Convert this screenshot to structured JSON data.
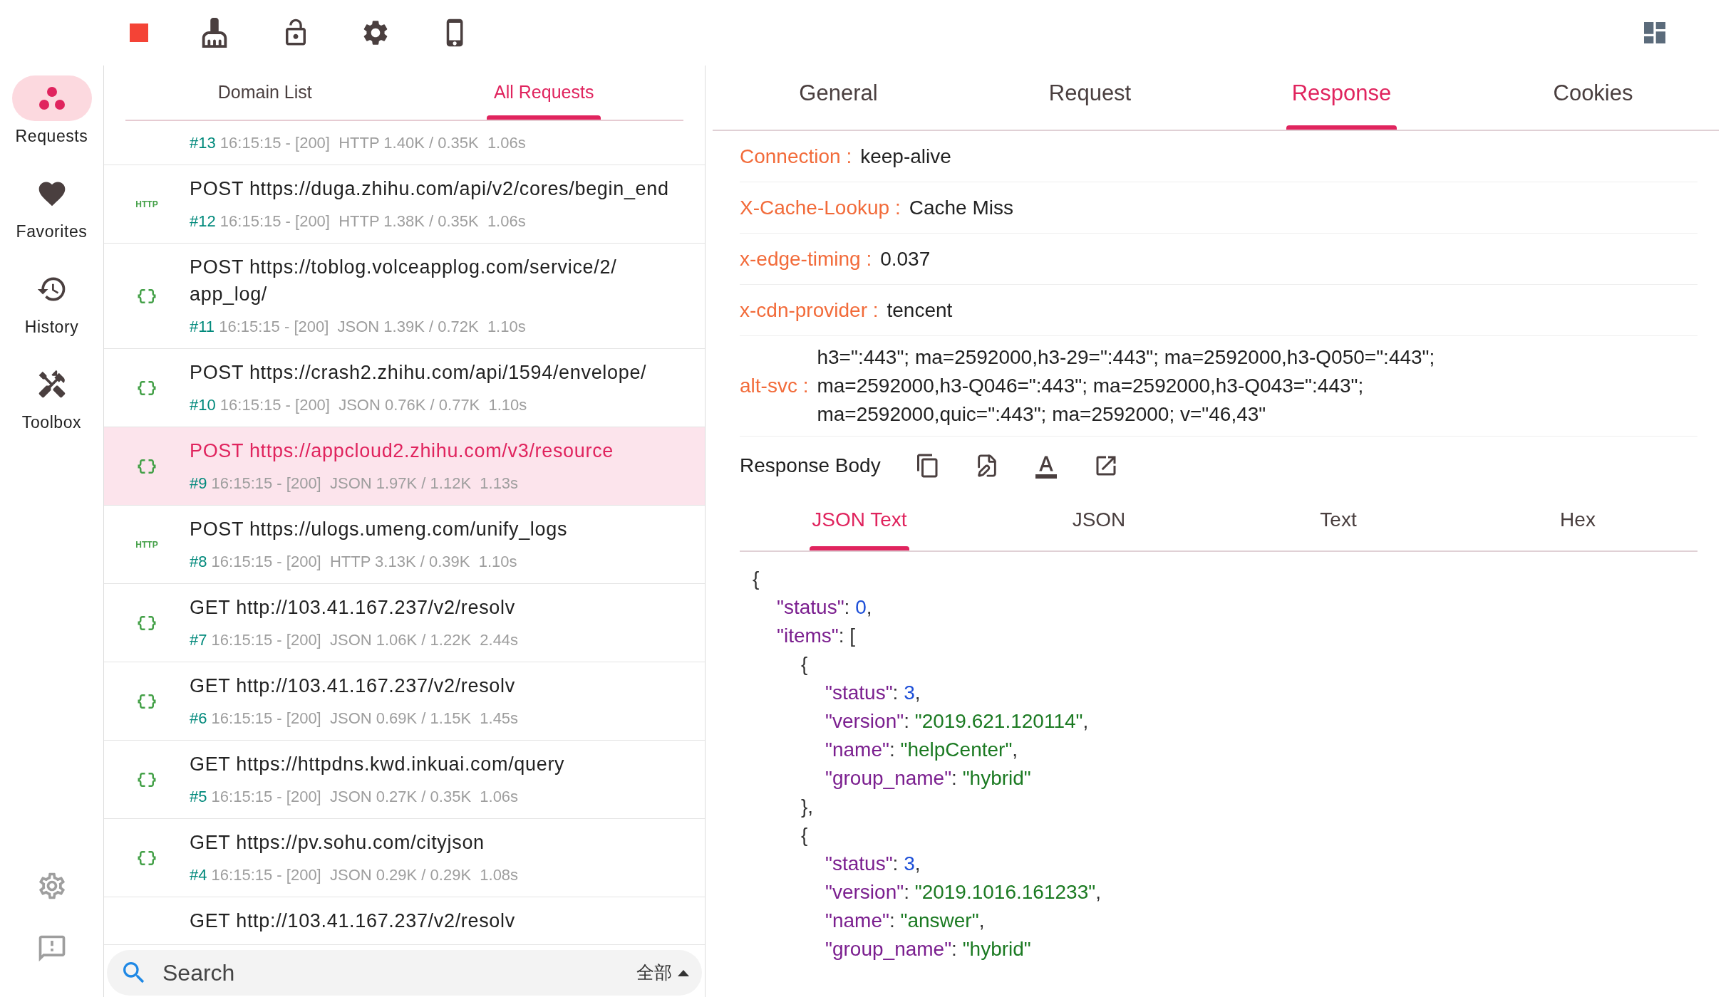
{
  "toolbar": {
    "recording": true
  },
  "sidebar": {
    "items": [
      {
        "label": "Requests",
        "kind": "requests",
        "selected": true
      },
      {
        "label": "Favorites",
        "kind": "favorites",
        "selected": false
      },
      {
        "label": "History",
        "kind": "history",
        "selected": false
      },
      {
        "label": "Toolbox",
        "kind": "toolbox",
        "selected": false
      }
    ]
  },
  "list_tabs": [
    {
      "label": "Domain List",
      "selected": false
    },
    {
      "label": "All Requests",
      "selected": true
    }
  ],
  "requests": [
    {
      "kind": "http",
      "number": "#13",
      "meta": "16:15:15 - [200]  HTTP 1.40K / 0.35K  1.06s",
      "selected": false
    },
    {
      "kind": "http",
      "badge": "HTTP",
      "title": "POST https://duga.zhihu.com/api/v2/cores/begin_end",
      "number": "#12",
      "meta": "16:15:15 - [200]  HTTP 1.38K / 0.35K  1.06s",
      "selected": false
    },
    {
      "kind": "json",
      "title": "POST https://toblog.volceapplog.com/service/2/ app_log/",
      "number": "#11",
      "meta": "16:15:15 - [200]  JSON 1.39K / 0.72K  1.10s",
      "selected": false
    },
    {
      "kind": "json",
      "title": "POST https://crash2.zhihu.com/api/1594/envelope/",
      "number": "#10",
      "meta": "16:15:15 - [200]  JSON 0.76K / 0.77K  1.10s",
      "selected": false
    },
    {
      "kind": "json",
      "title": "POST https://appcloud2.zhihu.com/v3/resource",
      "number": "#9",
      "meta": "16:15:15 - [200]  JSON 1.97K / 1.12K  1.13s",
      "selected": true
    },
    {
      "kind": "http",
      "badge": "HTTP",
      "title": "POST https://ulogs.umeng.com/unify_logs",
      "number": "#8",
      "meta": "16:15:15 - [200]  HTTP 3.13K / 0.39K  1.10s",
      "selected": false
    },
    {
      "kind": "json",
      "title": "GET http://103.41.167.237/v2/resolv",
      "number": "#7",
      "meta": "16:15:15 - [200]  JSON 1.06K / 1.22K  2.44s",
      "selected": false
    },
    {
      "kind": "json",
      "title": "GET http://103.41.167.237/v2/resolv",
      "number": "#6",
      "meta": "16:15:15 - [200]  JSON 0.69K / 1.15K  1.45s",
      "selected": false
    },
    {
      "kind": "json",
      "title": "GET https://httpdns.kwd.inkuai.com/query",
      "number": "#5",
      "meta": "16:15:15 - [200]  JSON 0.27K / 0.35K  1.06s",
      "selected": false
    },
    {
      "kind": "json",
      "title": "GET https://pv.sohu.com/cityjson",
      "number": "#4",
      "meta": "16:15:15 - [200]  JSON 0.29K / 0.29K  1.08s",
      "selected": false
    },
    {
      "kind": "json",
      "title": "GET http://103.41.167.237/v2/resolv",
      "selected": false
    }
  ],
  "search": {
    "placeholder": "Search",
    "filter": "全部"
  },
  "detail_tabs": [
    {
      "label": "General",
      "selected": false
    },
    {
      "label": "Request",
      "selected": false
    },
    {
      "label": "Response",
      "selected": true
    },
    {
      "label": "Cookies",
      "selected": false
    }
  ],
  "headers": [
    {
      "name": "Connection :",
      "value": "keep-alive"
    },
    {
      "name": "X-Cache-Lookup :",
      "value": "Cache Miss"
    },
    {
      "name": "x-edge-timing :",
      "value": "0.037"
    },
    {
      "name": "x-cdn-provider :",
      "value": "tencent"
    },
    {
      "name": "alt-svc :",
      "value": "h3=\":443\"; ma=2592000,h3-29=\":443\"; ma=2592000,h3-Q050=\":443\"; ma=2592000,h3-Q046=\":443\"; ma=2592000,h3-Q043=\":443\"; ma=2592000,quic=\":443\"; ma=2592000; v=\"46,43\""
    }
  ],
  "response_body": {
    "title": "Response Body",
    "tabs": [
      {
        "label": "JSON Text",
        "selected": true
      },
      {
        "label": "JSON",
        "selected": false
      },
      {
        "label": "Text",
        "selected": false
      },
      {
        "label": "Hex",
        "selected": false
      }
    ],
    "lines": [
      {
        "segments": [
          {
            "text": "{",
            "kind": "punct"
          }
        ],
        "children": [
          {
            "segments": [
              {
                "text": "\"status\"",
                "kind": "key"
              },
              {
                "text": ": ",
                "kind": "punct"
              },
              {
                "text": "0",
                "kind": "number"
              },
              {
                "text": ",",
                "kind": "punct"
              }
            ]
          },
          {
            "segments": [
              {
                "text": "\"items\"",
                "kind": "key"
              },
              {
                "text": ": [",
                "kind": "punct"
              }
            ],
            "children": [
              {
                "segments": [
                  {
                    "text": "{",
                    "kind": "punct"
                  }
                ],
                "children": [
                  {
                    "segments": [
                      {
                        "text": "\"status\"",
                        "kind": "key"
                      },
                      {
                        "text": ": ",
                        "kind": "punct"
                      },
                      {
                        "text": "3",
                        "kind": "number"
                      },
                      {
                        "text": ",",
                        "kind": "punct"
                      }
                    ]
                  },
                  {
                    "segments": [
                      {
                        "text": "\"version\"",
                        "kind": "key"
                      },
                      {
                        "text": ": ",
                        "kind": "punct"
                      },
                      {
                        "text": "\"2019.621.120114\"",
                        "kind": "string"
                      },
                      {
                        "text": ",",
                        "kind": "punct"
                      }
                    ]
                  },
                  {
                    "segments": [
                      {
                        "text": "\"name\"",
                        "kind": "key"
                      },
                      {
                        "text": ": ",
                        "kind": "punct"
                      },
                      {
                        "text": "\"helpCenter\"",
                        "kind": "string"
                      },
                      {
                        "text": ",",
                        "kind": "punct"
                      }
                    ]
                  },
                  {
                    "segments": [
                      {
                        "text": "\"group_name\"",
                        "kind": "key"
                      },
                      {
                        "text": ": ",
                        "kind": "punct"
                      },
                      {
                        "text": "\"hybrid\"",
                        "kind": "string"
                      }
                    ]
                  }
                ]
              },
              {
                "segments": [
                  {
                    "text": "},",
                    "kind": "punct"
                  }
                ]
              },
              {
                "segments": [
                  {
                    "text": "{",
                    "kind": "punct"
                  }
                ],
                "children": [
                  {
                    "segments": [
                      {
                        "text": "\"status\"",
                        "kind": "key"
                      },
                      {
                        "text": ": ",
                        "kind": "punct"
                      },
                      {
                        "text": "3",
                        "kind": "number"
                      },
                      {
                        "text": ",",
                        "kind": "punct"
                      }
                    ]
                  },
                  {
                    "segments": [
                      {
                        "text": "\"version\"",
                        "kind": "key"
                      },
                      {
                        "text": ": ",
                        "kind": "punct"
                      },
                      {
                        "text": "\"2019.1016.161233\"",
                        "kind": "string"
                      },
                      {
                        "text": ",",
                        "kind": "punct"
                      }
                    ]
                  },
                  {
                    "segments": [
                      {
                        "text": "\"name\"",
                        "kind": "key"
                      },
                      {
                        "text": ": ",
                        "kind": "punct"
                      },
                      {
                        "text": "\"answer\"",
                        "kind": "string"
                      },
                      {
                        "text": ",",
                        "kind": "punct"
                      }
                    ]
                  },
                  {
                    "segments": [
                      {
                        "text": "\"group_name\"",
                        "kind": "key"
                      },
                      {
                        "text": ": ",
                        "kind": "punct"
                      },
                      {
                        "text": "\"hybrid\"",
                        "kind": "string"
                      }
                    ]
                  }
                ]
              }
            ]
          }
        ]
      }
    ]
  }
}
